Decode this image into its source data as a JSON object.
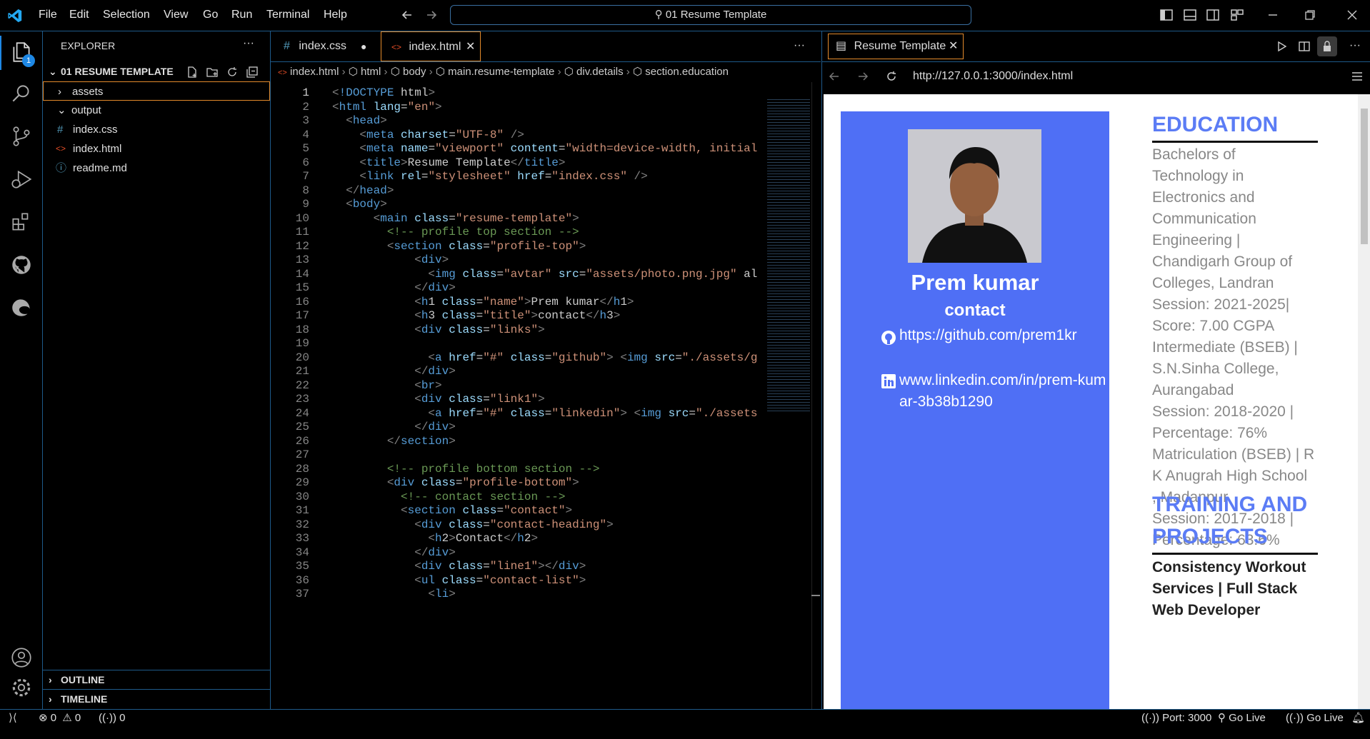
{
  "titlebar": {
    "menu": [
      "File",
      "Edit",
      "Selection",
      "View",
      "Go",
      "Run",
      "Terminal",
      "Help"
    ],
    "command_center": "01 Resume Template"
  },
  "activity": {
    "badge": "1"
  },
  "sidebar": {
    "title": "EXPLORER",
    "more": "···",
    "folder": "01 RESUME TEMPLATE",
    "items": [
      {
        "label": "assets",
        "kind": "folder"
      },
      {
        "label": "output",
        "kind": "folder"
      },
      {
        "label": "index.css",
        "kind": "css",
        "icon": "#"
      },
      {
        "label": "index.html",
        "kind": "html",
        "icon": "<>"
      },
      {
        "label": "readme.md",
        "kind": "info",
        "icon": "ⓘ"
      }
    ],
    "outline": "OUTLINE",
    "timeline": "TIMELINE"
  },
  "editor": {
    "tabs": [
      {
        "label": "index.css",
        "icon": "#"
      },
      {
        "label": "index.html",
        "icon": "<>"
      }
    ],
    "breadcrumbs": [
      "index.html",
      "html",
      "body",
      "main.resume-template",
      "div.details",
      "section.education"
    ],
    "lines": [
      "<!DOCTYPE html>",
      "<html lang=\"en\">",
      "  <head>",
      "    <meta charset=\"UTF-8\" />",
      "    <meta name=\"viewport\" content=\"width=device-width, initial",
      "    <title>Resume Template</title>",
      "    <link rel=\"stylesheet\" href=\"index.css\" />",
      "  </head>",
      "  <body>",
      "      <main class=\"resume-template\">",
      "        <!-- profile top section -->",
      "        <section class=\"profile-top\">",
      "            <div>",
      "              <img class=\"avtar\" src=\"assets/photo.png.jpg\" al",
      "            </div>",
      "            <h1 class=\"name\">Prem kumar</h1>",
      "            <h3 class=\"title\">contact</h3>",
      "            <div class=\"links\">",
      "",
      "              <a href=\"#\" class=\"github\"> <img src=\"./assets/g",
      "            </div>",
      "            <br>",
      "            <div class=\"link1\">",
      "              <a href=\"#\" class=\"linkedin\"> <img src=\"./assets",
      "            </div>",
      "        </section>",
      "",
      "        <!-- profile bottom section -->",
      "        <div class=\"profile-bottom\">",
      "          <!-- contact section -->",
      "          <section class=\"contact\">",
      "            <div class=\"contact-heading\">",
      "              <h2>Contact</h2>",
      "            </div>",
      "            <div class=\"line1\"></div>",
      "            <ul class=\"contact-list\">",
      "              <li>"
    ]
  },
  "preview": {
    "tab_label": "Resume Template",
    "url": "http://127.0.0.1:3000/index.html",
    "name": "Prem kumar",
    "contact": "contact",
    "github": "https://github.com/prem1kr",
    "linkedin": "www.linkedin.com/in/prem-kumar-3b38b1290",
    "education_heading": "EDUCATION",
    "education_lines": [
      "Bachelors of",
      "Technology in",
      "Electronics and",
      "Communication",
      "Engineering |",
      "Chandigarh Group of",
      "Colleges, Landran",
      "Session: 2021-2025|",
      "Score: 7.00 CGPA",
      "Intermediate (BSEB) |",
      "S.N.Sinha College,",
      "Aurangabad",
      "Session: 2018-2020 |",
      "Percentage: 76%",
      "Matriculation (BSEB) | R",
      "K Anugrah High School",
      ", Madanpur",
      "Session: 2017-2018 |",
      "Percentage: 63.6%"
    ],
    "training_heading_1": "TRAINING AND",
    "training_heading_2": "PROJECTS",
    "training_lines": [
      "Consistency Workout",
      "Services | Full Stack",
      "Web Developer"
    ]
  },
  "status": {
    "errors": "0",
    "warnings": "0",
    "ports": "0",
    "port": "Port: 3000",
    "golive1": "Go Live",
    "golive2": "Go Live"
  },
  "colors": {
    "accent": "#1e5a8a",
    "preview_blue": "#4f6ff5",
    "heading_blue": "#5b7cf5"
  }
}
